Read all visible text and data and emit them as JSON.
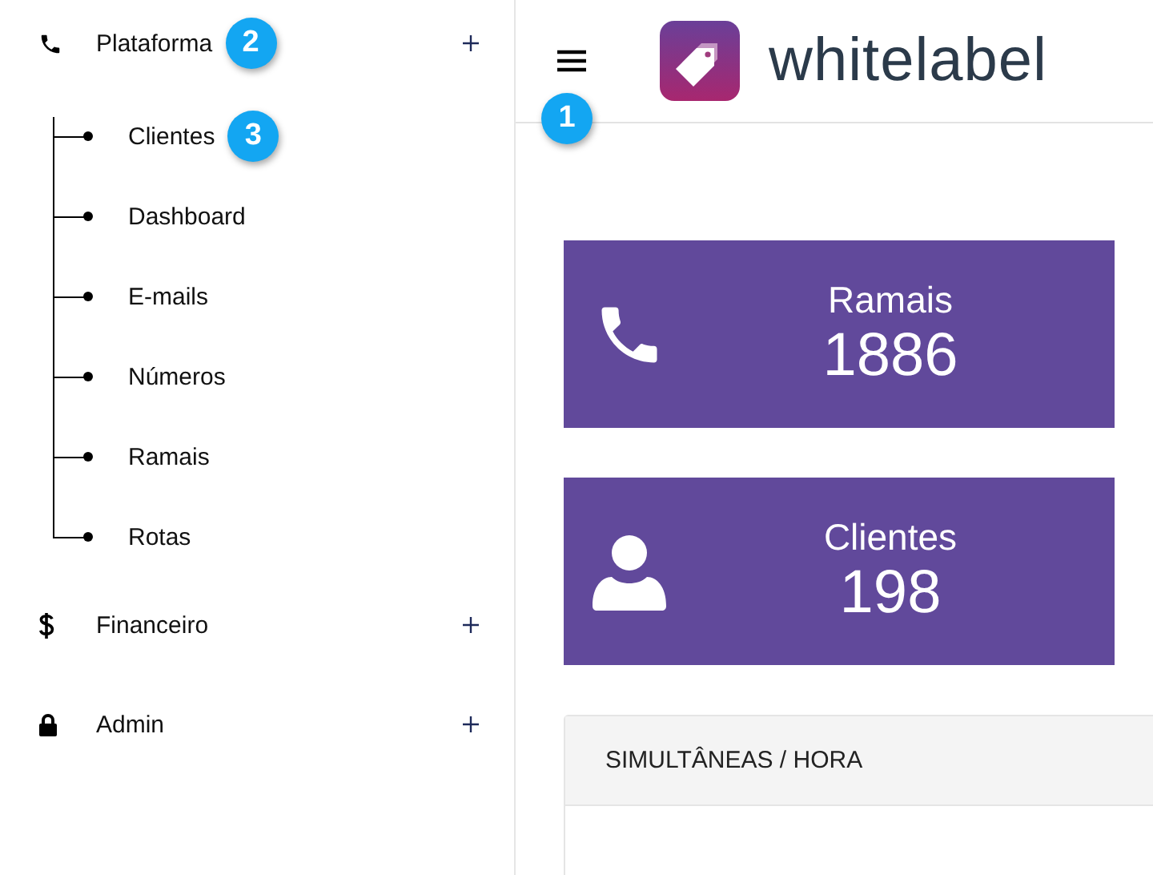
{
  "sidebar": {
    "items": [
      {
        "label": "Plataforma",
        "kind": "phone",
        "badge": "2",
        "children": [
          {
            "label": "Clientes",
            "badge": "3"
          },
          {
            "label": "Dashboard"
          },
          {
            "label": "E-mails"
          },
          {
            "label": "Números"
          },
          {
            "label": "Ramais"
          },
          {
            "label": "Rotas"
          }
        ]
      },
      {
        "label": "Financeiro",
        "kind": "dollar"
      },
      {
        "label": "Admin",
        "kind": "lock"
      }
    ]
  },
  "header": {
    "logo_text": "whitelabel",
    "menu_badge": "1"
  },
  "stats": [
    {
      "label": "Ramais",
      "value": "1886",
      "kind": "phone"
    },
    {
      "label": "Clientes",
      "value": "198",
      "kind": "user"
    }
  ],
  "panel": {
    "title": "SIMULTÂNEAS / HORA"
  }
}
